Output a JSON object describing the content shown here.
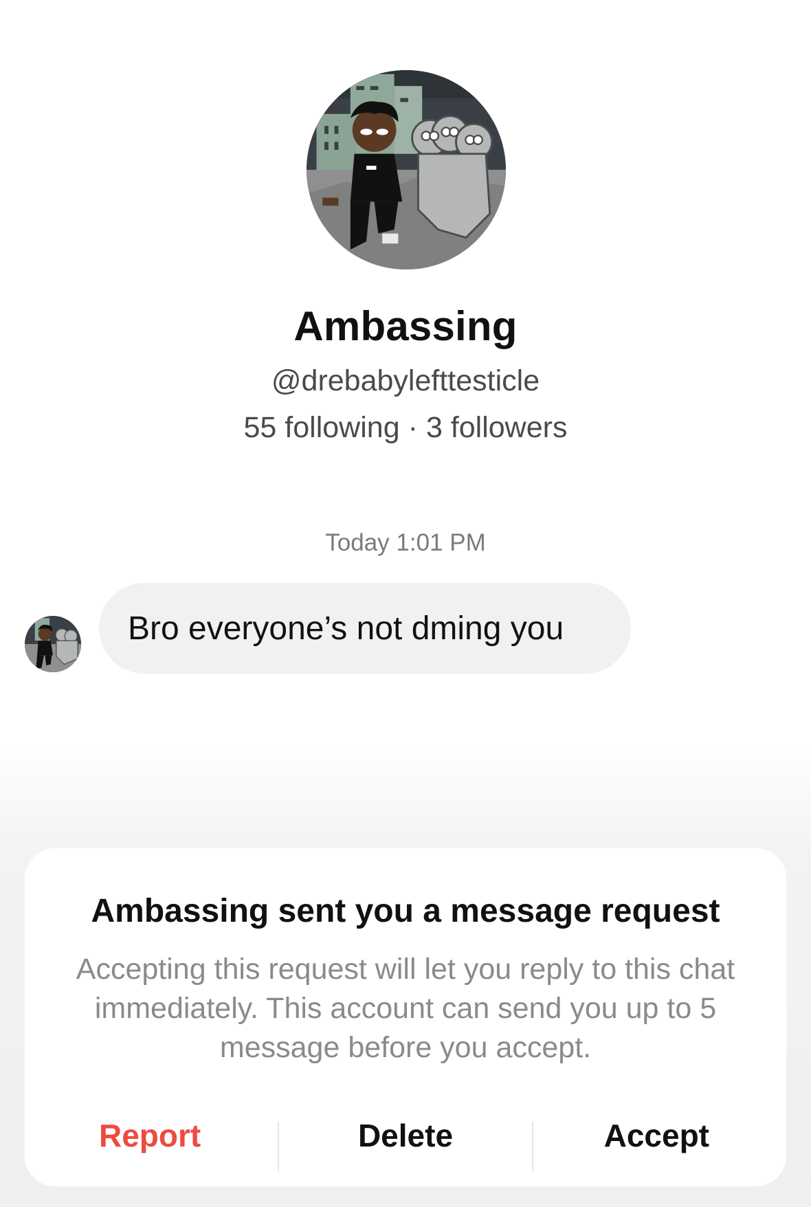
{
  "profile": {
    "display_name": "Ambassing",
    "username": "@drebabylefttesticle",
    "following": "55 following",
    "separator": "·",
    "followers": "3 followers"
  },
  "conversation": {
    "timestamp": "Today 1:01 PM",
    "messages": [
      {
        "text": "Bro everyone’s not dming you"
      }
    ]
  },
  "request_card": {
    "title": "Ambassing sent you a message request",
    "body": "Accepting this request will let you reply to this chat immediately. This account can send you up to 5 message before you accept.",
    "report_label": "Report",
    "delete_label": "Delete",
    "accept_label": "Accept"
  },
  "colors": {
    "report": "#ef4a3e",
    "bubble": "#f1f1f2",
    "secondary_text": "#4a4a4a",
    "muted_text": "#8a8a8a"
  }
}
